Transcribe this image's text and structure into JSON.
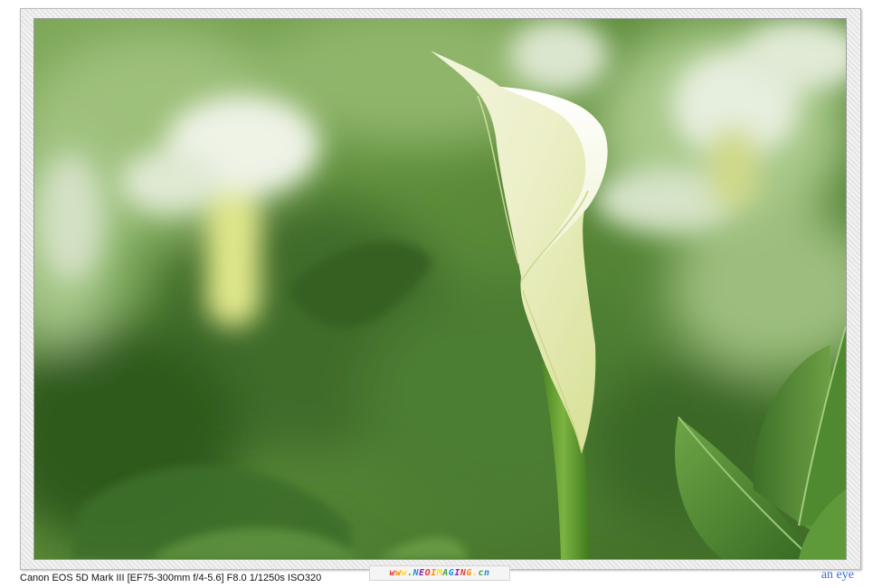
{
  "exif_caption": "Canon EOS 5D Mark III [EF75-300mm f/4-5.6] F8.0 1/1250s ISO320",
  "watermark": {
    "text": "www.NEOIMAGING.cn",
    "colors": [
      "#e53935",
      "#fb8c00",
      "#fdd835",
      "#43a047",
      "#1e88e5",
      "#8e24aa"
    ]
  },
  "signature": "an eye",
  "colors": {
    "signature": "#3b6bd8",
    "background_foliage": "#5f8f3c",
    "flower_spathe": "#f1f4d8",
    "stem": "#5e9a2e"
  }
}
